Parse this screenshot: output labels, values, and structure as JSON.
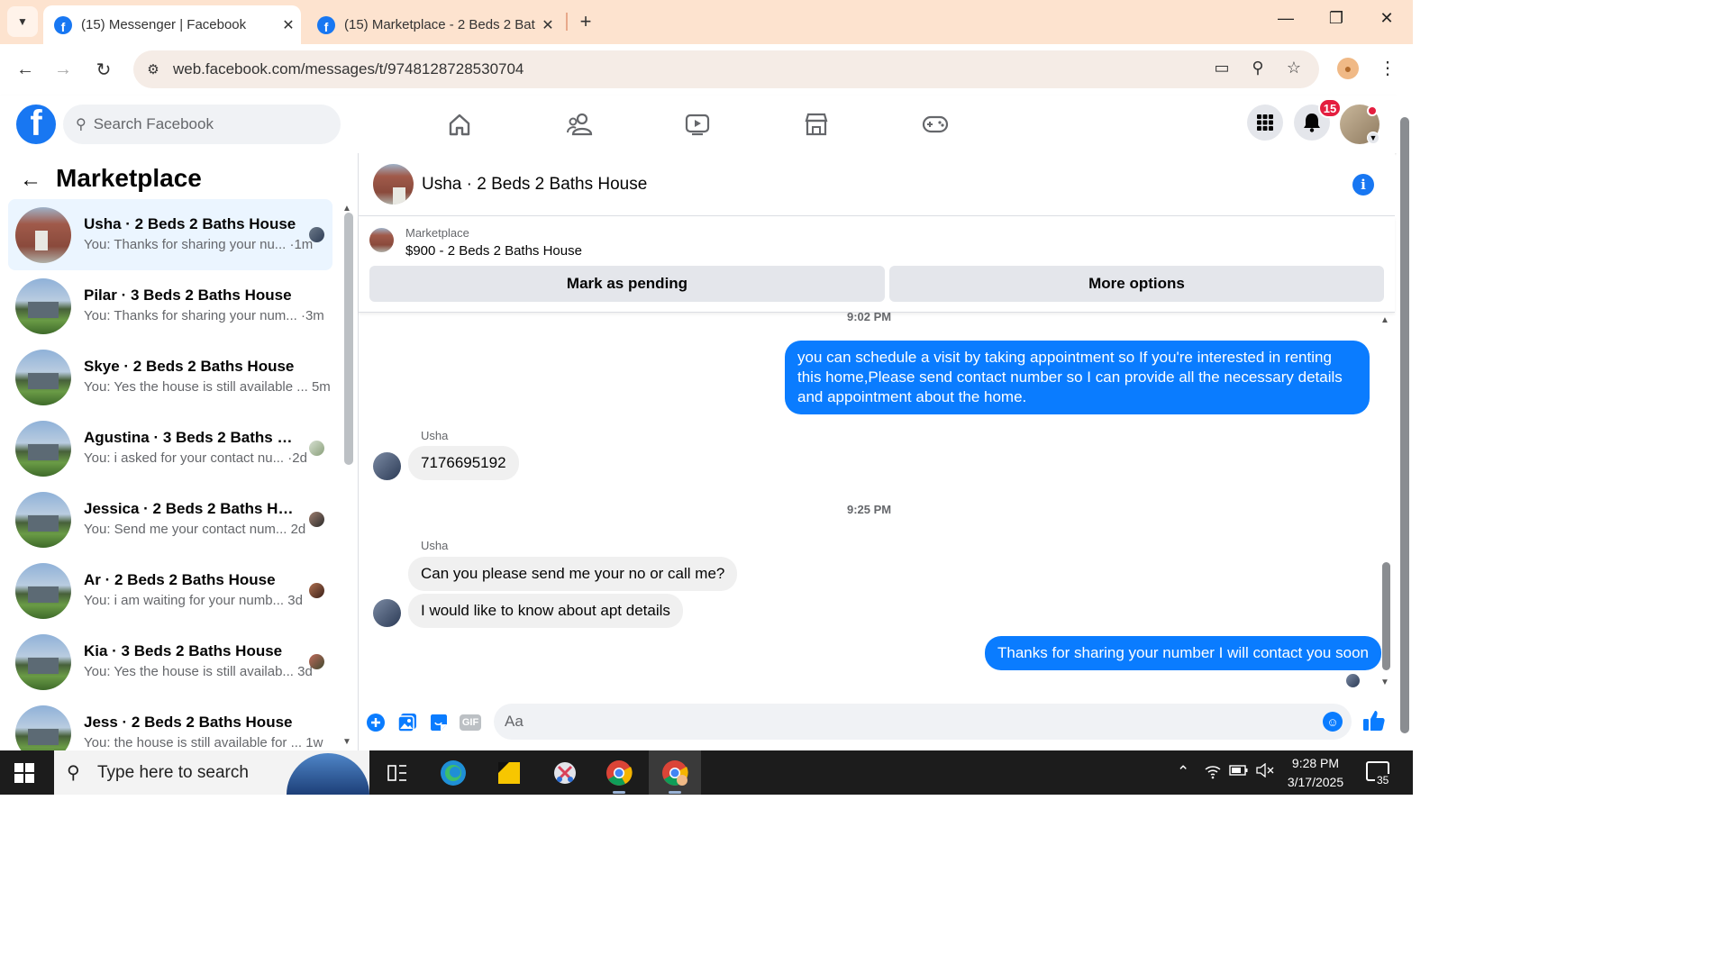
{
  "browser": {
    "tabs": [
      {
        "label": "(15) Messenger | Facebook",
        "active": true
      },
      {
        "label": "(15) Marketplace - 2 Beds 2 Bat",
        "active": false
      }
    ],
    "url": "web.facebook.com/messages/t/9748128728530704",
    "fav_letter": "f"
  },
  "fb": {
    "logo_letter": "f",
    "search_placeholder": "Search Facebook",
    "notification_count": "15",
    "nav_icons": [
      "home-icon",
      "friends-icon",
      "video-icon",
      "marketplace-icon",
      "gaming-icon"
    ]
  },
  "left_panel": {
    "title": "Marketplace",
    "conversations": [
      {
        "name": "Usha · 2 Beds 2 Baths House",
        "preview": "You: Thanks for sharing your nu... ·1m",
        "selected": true
      },
      {
        "name": "Pilar · 3 Beds 2 Baths House",
        "preview": "You: Thanks for sharing your num... ·3m",
        "selected": false
      },
      {
        "name": "Skye · 2 Beds 2 Baths House",
        "preview": "You: Yes the house is still available ... 5m",
        "selected": false
      },
      {
        "name": "Agustina · 3 Beds 2 Baths Ho...",
        "preview": "You: i asked for your contact nu... ·2d",
        "selected": false
      },
      {
        "name": "Jessica · 2 Beds 2 Baths House",
        "preview": "You: Send me your contact num... 2d",
        "selected": false
      },
      {
        "name": "Ar · 2 Beds 2 Baths House",
        "preview": "You: i am waiting for your numb... 3d",
        "selected": false
      },
      {
        "name": "Kia · 3 Beds 2 Baths House",
        "preview": "You: Yes the house is still availab... 3d",
        "selected": false
      },
      {
        "name": "Jess · 2 Beds 2 Baths House",
        "preview": "You: the house is still available for ... 1w",
        "selected": false
      }
    ]
  },
  "chat": {
    "title": "Usha · 2 Beds 2 Baths House",
    "listing_label": "Marketplace",
    "listing_price": "$900 - 2 Beds 2 Baths House",
    "mark_pending_label": "Mark as pending",
    "more_options_label": "More options",
    "timestamps": [
      "9:02 PM",
      "9:25 PM"
    ],
    "sender_name": "Usha",
    "messages": {
      "out1": "you can schedule a visit by taking appointment so  If you're interested in renting this home,Please send contact number so I can provide all the necessary details and appointment about the home.",
      "in1": "7176695192",
      "in2": "Can you please send me your no or call me?",
      "in3": "I would like to know about apt details",
      "out2": "Thanks for sharing your number I will contact you soon"
    },
    "composer_placeholder": "Aa",
    "gif_label": "GIF"
  },
  "taskbar": {
    "search_placeholder": "Type here to search",
    "time": "9:28 PM",
    "date": "3/17/2025",
    "notification_count": "35"
  }
}
